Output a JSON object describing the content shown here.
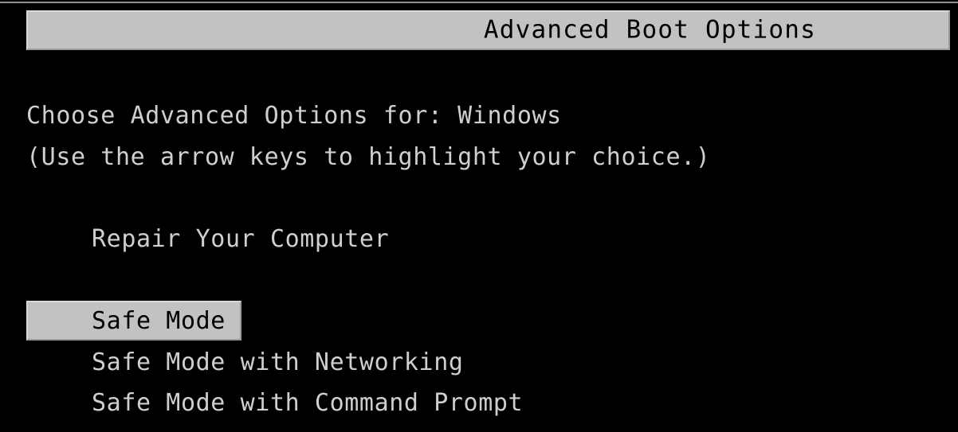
{
  "screen": {
    "background_color": "#000000",
    "text_color": "#cfcfcf",
    "highlight_color": "#c2c2c2",
    "highlight_text_color": "#000000"
  },
  "title_bar": {
    "title": "Advanced Boot Options"
  },
  "body": {
    "prompt_line": "Choose Advanced Options for: Windows",
    "hint_line": "(Use the arrow keys to highlight your choice.)"
  },
  "menu": {
    "items": [
      {
        "label": "Repair Your Computer",
        "selected": false
      },
      {
        "label": "Safe Mode",
        "selected": true
      },
      {
        "label": "Safe Mode with Networking",
        "selected": false
      },
      {
        "label": "Safe Mode with Command Prompt",
        "selected": false
      }
    ]
  }
}
